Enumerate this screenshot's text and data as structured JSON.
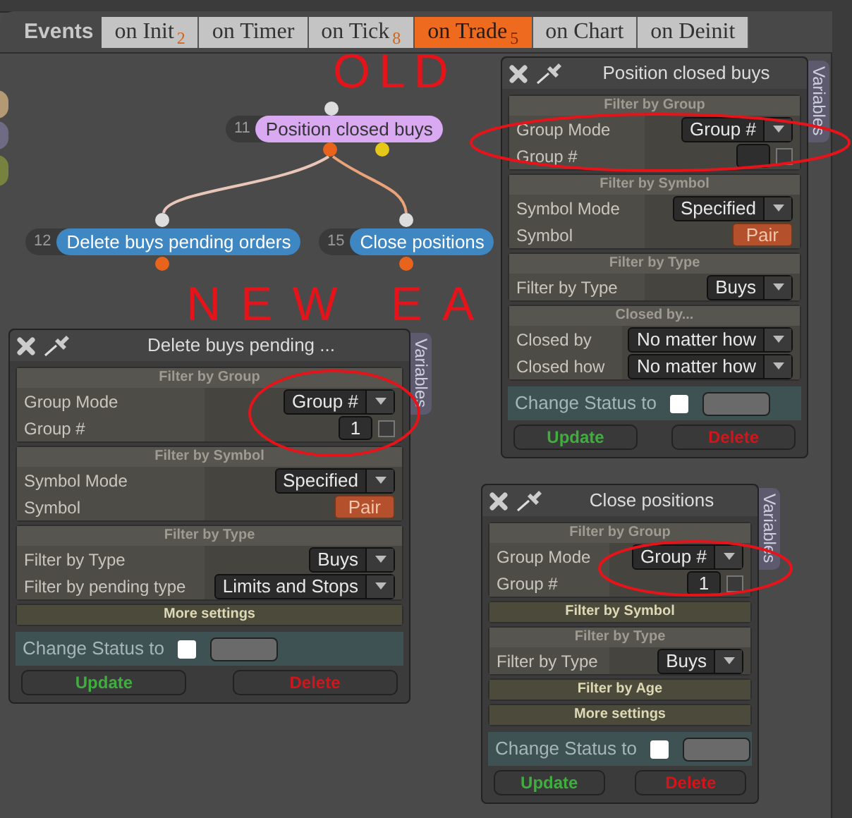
{
  "events_label": "Events",
  "tabs": [
    {
      "label": "on Init",
      "badge": "2",
      "selected": false
    },
    {
      "label": "on Timer",
      "selected": false
    },
    {
      "label": "on Tick",
      "badge": "8",
      "selected": false
    },
    {
      "label": "on Trade",
      "badge": "5",
      "selected": true
    },
    {
      "label": "on Chart",
      "selected": false
    },
    {
      "label": "on Deinit",
      "selected": false
    }
  ],
  "nodes": [
    {
      "number": "11",
      "label": "Position closed buys",
      "color": "#d9aaf2"
    },
    {
      "number": "12",
      "label": "Delete buys pending orders",
      "color": "#3f87c2"
    },
    {
      "number": "15",
      "label": "Close positions",
      "color": "#3f87c2"
    }
  ],
  "annotations": [
    {
      "text": "OLD"
    },
    {
      "text": "NEW EA"
    }
  ],
  "panels": [
    {
      "title": "Position closed buys",
      "side_tab": "Variables",
      "sections": [
        {
          "heading": "Filter by Group",
          "expanded": true,
          "rows": [
            {
              "label": "Group Mode",
              "kind": "dropdown",
              "value": "Group #"
            },
            {
              "label": "Group #",
              "kind": "number",
              "checked": false
            }
          ]
        },
        {
          "heading": "Filter by Symbol",
          "expanded": true,
          "rows": [
            {
              "label": "Symbol Mode",
              "kind": "dropdown",
              "value": "Specified"
            },
            {
              "label": "Symbol",
              "kind": "button",
              "value": "Pair"
            }
          ]
        },
        {
          "heading": "Filter by Type",
          "expanded": true,
          "rows": [
            {
              "label": "Filter by Type",
              "kind": "dropdown",
              "value": "Buys"
            }
          ]
        },
        {
          "heading": "Closed by...",
          "expanded": true,
          "rows": [
            {
              "label": "Closed by",
              "kind": "dropdown",
              "value": "No matter how"
            },
            {
              "label": "Closed how",
              "kind": "dropdown",
              "value": "No matter how"
            }
          ]
        }
      ],
      "change_status": {
        "label": "Change Status to",
        "checked": false
      },
      "buttons": [
        "Update",
        "Delete"
      ]
    },
    {
      "title": "Delete buys pending ...",
      "side_tab": "Variables",
      "sections": [
        {
          "heading": "Filter by Group",
          "expanded": true,
          "rows": [
            {
              "label": "Group Mode",
              "kind": "dropdown",
              "value": "Group #"
            },
            {
              "label": "Group #",
              "kind": "number",
              "value": "1",
              "checked": false
            }
          ]
        },
        {
          "heading": "Filter by Symbol",
          "expanded": true,
          "rows": [
            {
              "label": "Symbol Mode",
              "kind": "dropdown",
              "value": "Specified"
            },
            {
              "label": "Symbol",
              "kind": "button",
              "value": "Pair"
            }
          ]
        },
        {
          "heading": "Filter by Type",
          "expanded": true,
          "rows": [
            {
              "label": "Filter by Type",
              "kind": "dropdown",
              "value": "Buys"
            },
            {
              "label": "Filter by pending type",
              "kind": "dropdown",
              "value": "Limits and Stops"
            }
          ]
        },
        {
          "heading": "More settings",
          "expanded": false
        }
      ],
      "change_status": {
        "label": "Change Status to",
        "checked": false
      },
      "buttons": [
        "Update",
        "Delete"
      ]
    },
    {
      "title": "Close positions",
      "side_tab": "Variables",
      "sections": [
        {
          "heading": "Filter by Group",
          "expanded": true,
          "rows": [
            {
              "label": "Group Mode",
              "kind": "dropdown",
              "value": "Group #"
            },
            {
              "label": "Group #",
              "kind": "number",
              "value": "1",
              "checked": false
            }
          ]
        },
        {
          "heading": "Filter by Symbol",
          "expanded": false
        },
        {
          "heading": "Filter by Type",
          "expanded": true,
          "rows": [
            {
              "label": "Filter by Type",
              "kind": "dropdown",
              "value": "Buys"
            }
          ]
        },
        {
          "heading": "Filter by Age",
          "expanded": false
        },
        {
          "heading": "More settings",
          "expanded": false
        }
      ],
      "change_status": {
        "label": "Change Status to",
        "checked": false
      },
      "buttons": [
        "Update",
        "Delete"
      ]
    }
  ]
}
